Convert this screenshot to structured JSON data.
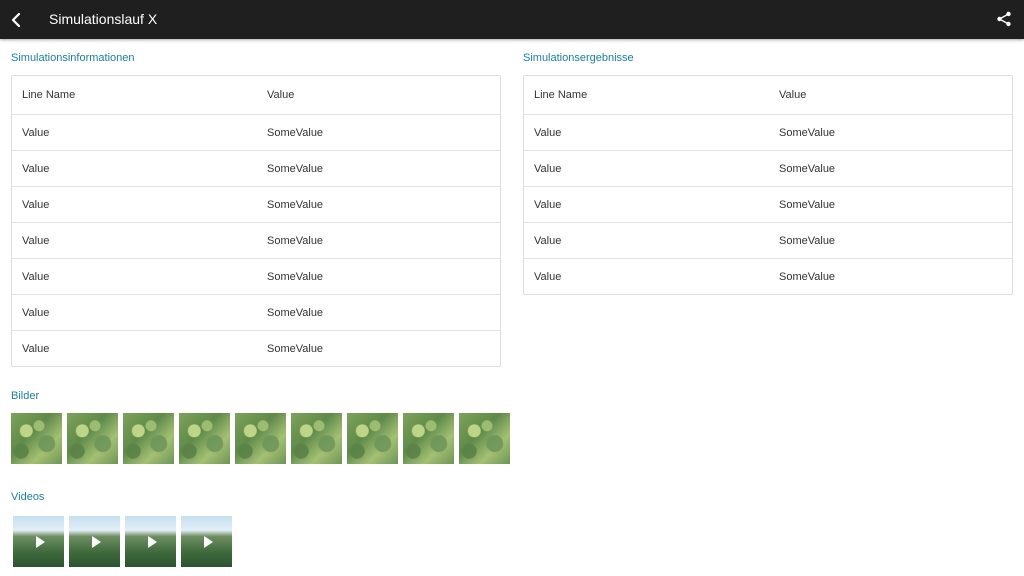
{
  "appbar": {
    "title": "Simulationslauf X",
    "back_icon": "chevron-left-icon",
    "share_icon": "share-icon",
    "background": "#1f1f1f"
  },
  "sim_info": {
    "title": "Simulationsinformationen",
    "header": {
      "name": "Line Name",
      "value": "Value"
    },
    "rows": [
      {
        "name": "Value",
        "value": "SomeValue"
      },
      {
        "name": "Value",
        "value": "SomeValue"
      },
      {
        "name": "Value",
        "value": "SomeValue"
      },
      {
        "name": "Value",
        "value": "SomeValue"
      },
      {
        "name": "Value",
        "value": "SomeValue"
      },
      {
        "name": "Value",
        "value": "SomeValue"
      },
      {
        "name": "Value",
        "value": "SomeValue"
      }
    ]
  },
  "sim_results": {
    "title": "Simulationsergebnisse",
    "header": {
      "name": "Line Name",
      "value": "Value"
    },
    "rows": [
      {
        "name": "Value",
        "value": "SomeValue"
      },
      {
        "name": "Value",
        "value": "SomeValue"
      },
      {
        "name": "Value",
        "value": "SomeValue"
      },
      {
        "name": "Value",
        "value": "SomeValue"
      },
      {
        "name": "Value",
        "value": "SomeValue"
      }
    ]
  },
  "images": {
    "title": "Bilder",
    "count": 9
  },
  "videos": {
    "title": "Videos",
    "count": 4,
    "overlay_icon": "play-icon"
  },
  "colors": {
    "accent": "#1a7f99",
    "appbar": "#1f1f1f"
  }
}
